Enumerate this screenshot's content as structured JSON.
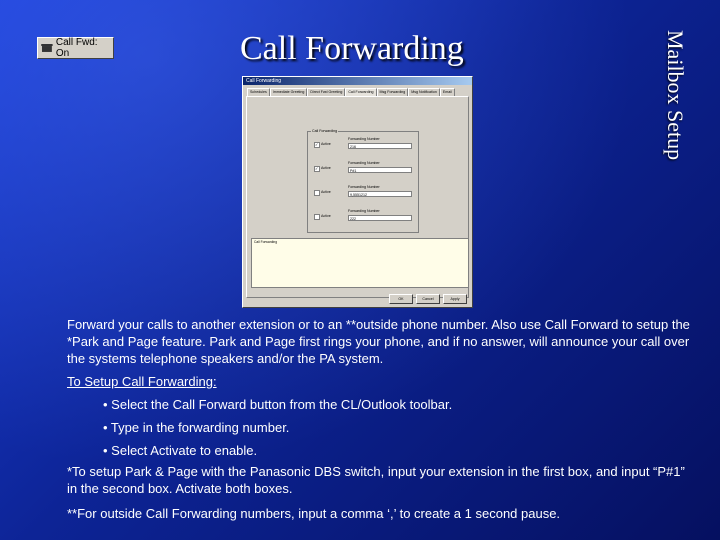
{
  "slide": {
    "title": "Call Forwarding",
    "side_title": "Mailbox Setup"
  },
  "toolbar_button": {
    "label": "Call Fwd: On"
  },
  "dialog": {
    "window_title": "Call Forwarding",
    "tabs": [
      "Schedules",
      "Immediate Greeting",
      "Direct Fwd Greeting",
      "Call Forwarding",
      "Msg Forwarding",
      "Msg Notification",
      "Email"
    ],
    "group_label": "Call Forwarding",
    "rows": [
      {
        "checked": true,
        "active_label": "Active",
        "field_label": "Forwarding Number",
        "value": "216"
      },
      {
        "checked": true,
        "active_label": "Active",
        "field_label": "Forwarding Number",
        "value": "P#1"
      },
      {
        "checked": false,
        "active_label": "Active",
        "field_label": "Forwarding Number",
        "value": "9,5551212"
      },
      {
        "checked": false,
        "active_label": "Active",
        "field_label": "Forwarding Number",
        "value": "222"
      }
    ],
    "buttons": [
      "OK",
      "Cancel",
      "Apply"
    ]
  },
  "content": {
    "intro": "Forward your calls to another extension or to an **outside phone number.  Also use Call Forward to setup the *Park and Page feature.  Park and Page first rings your phone, and if no answer, will announce your call over the systems telephone speakers and/or the PA system.",
    "setup_heading": "To Setup Call Forwarding:",
    "bullets": [
      "• Select the Call Forward button from the CL/Outlook toolbar.",
      "• Type in the forwarding number.",
      "• Select Activate to enable."
    ],
    "note_park": "*To setup Park & Page with the Panasonic DBS switch, input your extension in the first box, and input “P#1” in the second box.  Activate both boxes.",
    "note_outside": "**For outside Call Forwarding numbers, input a comma ‘,’ to create a 1 second pause."
  }
}
